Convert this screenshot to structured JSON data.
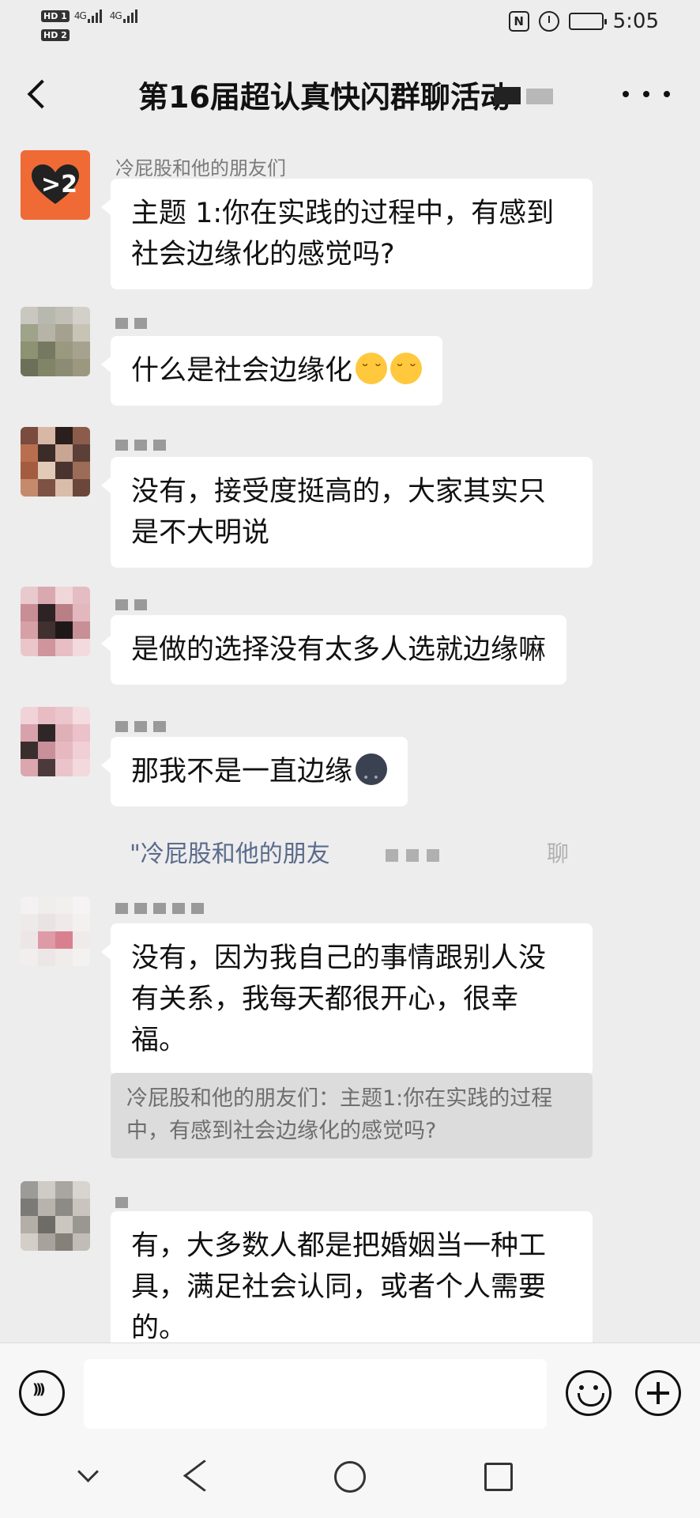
{
  "status_bar": {
    "sim1": "HD 1",
    "sim2": "HD 2",
    "network1": "4G",
    "network2": "4G",
    "time": "5:05",
    "nfc_label": "N"
  },
  "header": {
    "title": "第16届超认真快闪群聊活动"
  },
  "messages": [
    {
      "sender": "冷屁股和他的朋友们",
      "text": "主题 1:你在实践的过程中，有感到社会边缘化的感觉吗?"
    },
    {
      "sender": "",
      "text": "什么是社会边缘化"
    },
    {
      "sender": "",
      "text": "没有，接受度挺高的，大家其实只是不大明说"
    },
    {
      "sender": "",
      "text": "是做的选择没有太多人选就边缘嘛"
    },
    {
      "sender": "",
      "text": "那我不是一直边缘"
    },
    {
      "sender": "",
      "text": "没有，因为我自己的事情跟别人没有关系，我每天都很开心，很幸福。"
    },
    {
      "sender": "",
      "text": "有，大多数人都是把婚姻当一种工具，满足社会认同，或者个人需要的。"
    }
  ],
  "system_tip": {
    "text": "\"冷屁股和他的朋友",
    "trailing": "聊"
  },
  "avatar_badge": ">2",
  "quote": {
    "text": "冷屁股和他的朋友们：主题1:你在实践的过程中，有感到社会边缘化的感觉吗?"
  },
  "input": {
    "value": "",
    "placeholder": ""
  },
  "colors": {
    "background": "#ededed",
    "bubble": "#ffffff",
    "brand_avatar": "#f06a36",
    "link_tip": "#5b6b8c"
  },
  "icons": {
    "back": "chevron-left-icon",
    "more": "more-dots-icon",
    "voice": "voice-icon",
    "emoji": "emoji-icon",
    "plus": "plus-icon"
  }
}
